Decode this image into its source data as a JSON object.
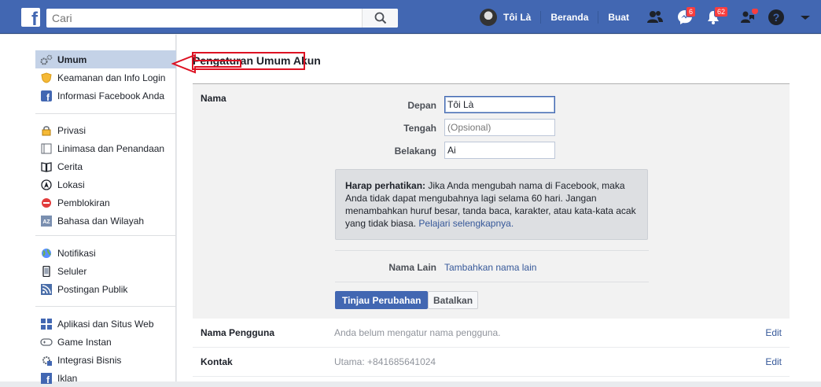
{
  "topbar": {
    "search_placeholder": "Cari",
    "profile_name": "Tôi Là",
    "home_label": "Beranda",
    "create_label": "Buat",
    "messages_badge": "6",
    "notifications_badge": "62",
    "colors": {
      "bar": "#4267b2",
      "badge": "#fa3e3e"
    }
  },
  "sidebar": {
    "groups": [
      [
        {
          "label": "Umum",
          "icon": "gears-icon"
        },
        {
          "label": "Keamanan dan Info Login",
          "icon": "shield-icon"
        },
        {
          "label": "Informasi Facebook Anda",
          "icon": "facebook-icon"
        }
      ],
      [
        {
          "label": "Privasi",
          "icon": "lock-icon"
        },
        {
          "label": "Linimasa dan Penandaan",
          "icon": "timeline-icon"
        },
        {
          "label": "Cerita",
          "icon": "book-icon"
        },
        {
          "label": "Lokasi",
          "icon": "location-icon"
        },
        {
          "label": "Pemblokiran",
          "icon": "block-icon"
        },
        {
          "label": "Bahasa dan Wilayah",
          "icon": "language-icon"
        }
      ],
      [
        {
          "label": "Notifikasi",
          "icon": "globe-icon"
        },
        {
          "label": "Seluler",
          "icon": "mobile-icon"
        },
        {
          "label": "Postingan Publik",
          "icon": "rss-icon"
        }
      ],
      [
        {
          "label": "Aplikasi dan Situs Web",
          "icon": "apps-icon"
        },
        {
          "label": "Game Instan",
          "icon": "gamepad-icon"
        },
        {
          "label": "Integrasi Bisnis",
          "icon": "business-icon"
        },
        {
          "label": "Iklan",
          "icon": "ads-icon"
        }
      ]
    ]
  },
  "main": {
    "title": "Pengaturan Umum Akun",
    "name_section": {
      "label": "Nama",
      "first_label": "Depan",
      "first_value": "Tôi Là",
      "middle_label": "Tengah",
      "middle_placeholder": "(Opsional)",
      "last_label": "Belakang",
      "last_value": "Ai",
      "notice_bold": "Harap perhatikan:",
      "notice_text": " Jika Anda mengubah nama di Facebook, maka Anda tidak dapat mengubahnya lagi selama 60 hari. Jangan menambahkan huruf besar, tanda baca, karakter, atau kata-kata acak yang tidak biasa. ",
      "notice_link": "Pelajari selengkapnya.",
      "other_names_label": "Nama Lain",
      "other_names_link": "Tambahkan nama lain",
      "review_button": "Tinjau Perubahan",
      "cancel_button": "Batalkan"
    },
    "rows": [
      {
        "label": "Nama Pengguna",
        "value": "Anda belum mengatur nama pengguna.",
        "edit": "Edit"
      },
      {
        "label": "Kontak",
        "value": "Utama: +841685641024",
        "edit": "Edit"
      }
    ]
  }
}
